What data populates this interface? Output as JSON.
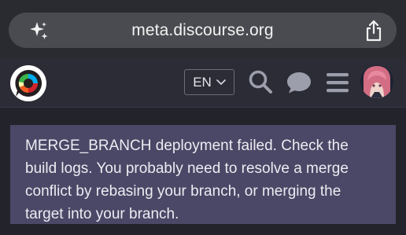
{
  "browser": {
    "url": "meta.discourse.org",
    "left_icon": "sparkle-icon",
    "right_icon": "share-icon"
  },
  "header": {
    "language_label": "EN",
    "icons": [
      "discourse-logo-icon",
      "chevron-down-icon",
      "search-icon",
      "chat-icon",
      "hamburger-menu-icon",
      "avatar"
    ]
  },
  "notice": {
    "text": "MERGE_BRANCH deployment failed. Check the build logs. You probably need to resolve a merge conflict by rebasing your branch, or merging the target into your branch."
  },
  "colors": {
    "browser_bg": "#2a2b30",
    "url_pill": "#4a4b50",
    "header_bg": "#2b2c36",
    "page_bg": "#22232b",
    "notice_bg": "#4b4766"
  }
}
